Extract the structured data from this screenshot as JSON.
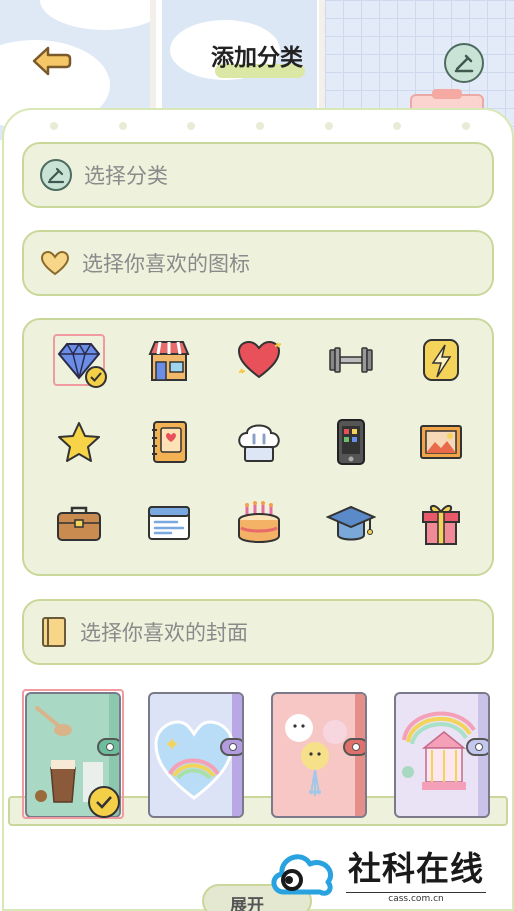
{
  "header": {
    "title": "添加分类"
  },
  "category_field": {
    "placeholder": "选择分类"
  },
  "icon_field": {
    "placeholder": "选择你喜欢的图标"
  },
  "icons": [
    {
      "name": "diamond-icon",
      "selected": true
    },
    {
      "name": "shop-icon",
      "selected": false
    },
    {
      "name": "heart-icon",
      "selected": false
    },
    {
      "name": "dumbbell-icon",
      "selected": false
    },
    {
      "name": "lightning-icon",
      "selected": false
    },
    {
      "name": "star-icon",
      "selected": false
    },
    {
      "name": "notebook-icon",
      "selected": false
    },
    {
      "name": "chef-hat-icon",
      "selected": false
    },
    {
      "name": "phone-icon",
      "selected": false
    },
    {
      "name": "picture-icon",
      "selected": false
    },
    {
      "name": "briefcase-icon",
      "selected": false
    },
    {
      "name": "browser-card-icon",
      "selected": false
    },
    {
      "name": "cake-icon",
      "selected": false
    },
    {
      "name": "graduation-cap-icon",
      "selected": false
    },
    {
      "name": "gift-icon",
      "selected": false
    }
  ],
  "cover_field": {
    "placeholder": "选择你喜欢的封面"
  },
  "covers": [
    {
      "name": "milk-tea-cover",
      "color": "#a9d9c4",
      "spine": "#8cc8ae",
      "tab": "#6bbd9c",
      "selected": true
    },
    {
      "name": "rainbow-heart-cover",
      "color": "#dde3f7",
      "spine": "#b9a7e6",
      "tab": "#b39be0",
      "selected": false
    },
    {
      "name": "cute-bears-cover",
      "color": "#f6c7c4",
      "spine": "#e58f8a",
      "tab": "#e0706b",
      "selected": false
    },
    {
      "name": "carousel-cover",
      "color": "#e9e3f5",
      "spine": "#c9c3ea",
      "tab": "#c3c7ee",
      "selected": false
    }
  ],
  "bottom": {
    "expand_label": "展开"
  },
  "watermark": {
    "title": "社科在线",
    "domain": "cass.com.cn"
  },
  "colors": {
    "field_bg": "#eef2dd",
    "field_border": "#c9d79a",
    "selected_border": "#f19aa0",
    "check_yellow": "#f4d048"
  }
}
